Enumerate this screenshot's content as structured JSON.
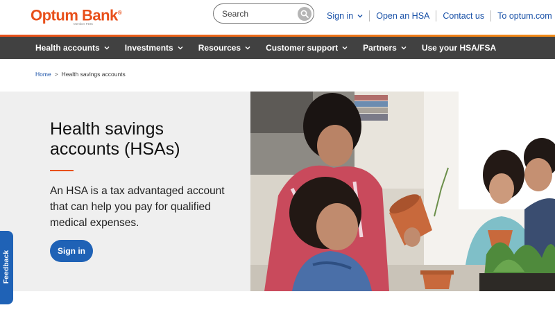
{
  "header": {
    "logo_text": "Optum Bank",
    "logo_registered": "®",
    "logo_sub": "Member FDIC",
    "brand_color": "#e8501b",
    "search": {
      "placeholder": "Search",
      "value": ""
    },
    "links": [
      {
        "label": "Sign in",
        "has_dropdown": true
      },
      {
        "label": "Open an HSA"
      },
      {
        "label": "Contact us"
      },
      {
        "label": "To optum.com"
      }
    ]
  },
  "nav": {
    "items": [
      {
        "label": "Health accounts",
        "has_dropdown": true
      },
      {
        "label": "Investments",
        "has_dropdown": true
      },
      {
        "label": "Resources",
        "has_dropdown": true
      },
      {
        "label": "Customer support",
        "has_dropdown": true
      },
      {
        "label": "Partners",
        "has_dropdown": true
      },
      {
        "label": "Use your HSA/FSA",
        "has_dropdown": false
      }
    ]
  },
  "breadcrumb": {
    "home": "Home",
    "separator": ">",
    "current": "Health savings accounts"
  },
  "hero": {
    "title": "Health savings accounts (HSAs)",
    "description": "An HSA is a tax advantaged account that can help you pay for qualified medical expenses.",
    "button_label": "Sign in",
    "image_icon": "family-gardening-photo"
  },
  "feedback": {
    "label": "Feedback"
  },
  "colors": {
    "link_blue": "#1a52a8",
    "button_blue": "#1f62b6",
    "nav_bg": "#414141",
    "hero_bg": "#efefef"
  }
}
